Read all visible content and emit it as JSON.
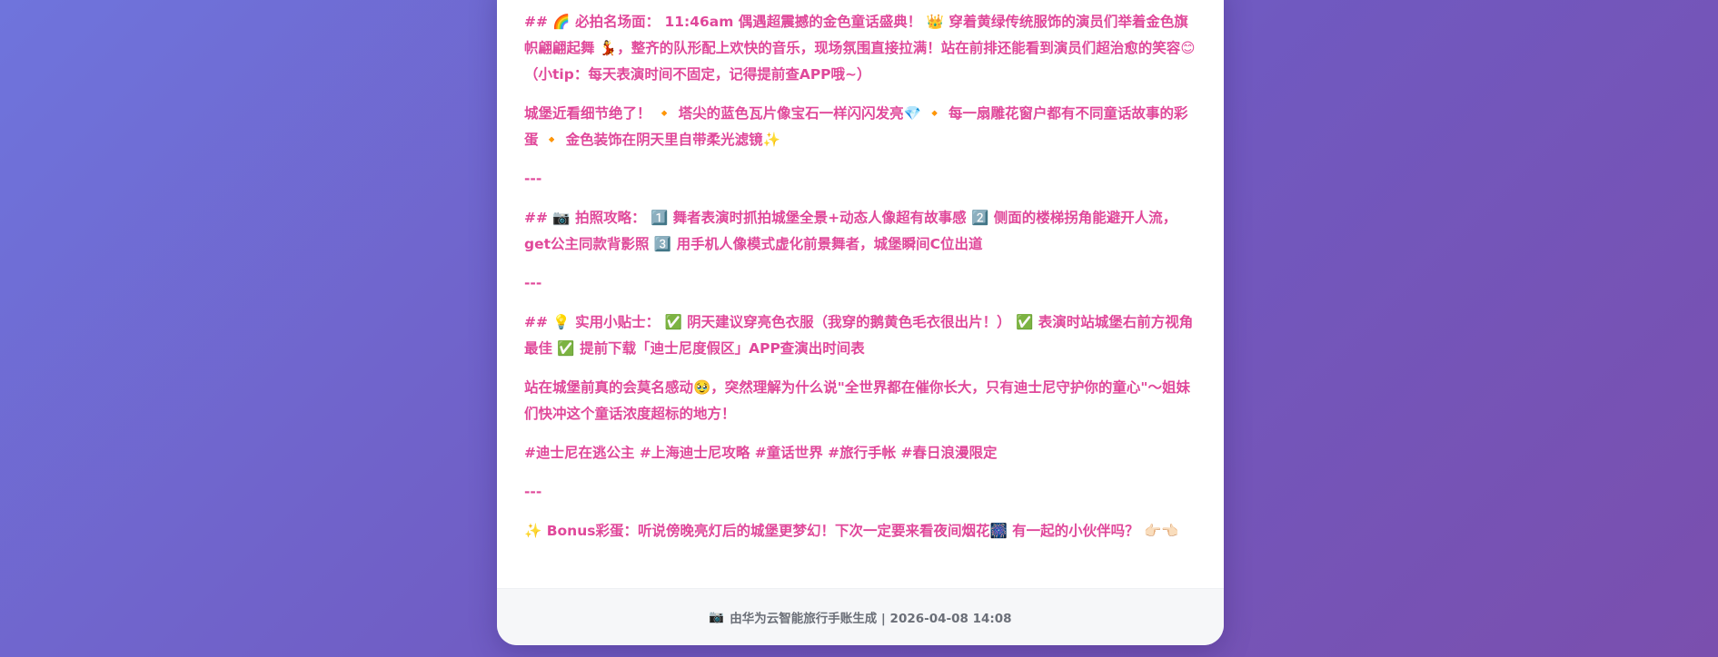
{
  "post": {
    "p1": "## 🌈 必拍名场面： 11:46am 偶遇超震撼的金色童话盛典！ 👑 穿着黄绿传统服饰的演员们举着金色旗帜翩翩起舞 💃，整齐的队形配上欢快的音乐，现场氛围直接拉满！站在前排还能看到演员们超治愈的笑容😊（小tip：每天表演时间不固定，记得提前查APP哦~）",
    "p2": "城堡近看细节绝了！ 🔸 塔尖的蓝色瓦片像宝石一样闪闪发亮💎 🔸 每一扇雕花窗户都有不同童话故事的彩蛋 🔸 金色装饰在阴天里自带柔光滤镜✨",
    "sep1": "---",
    "p3": "## 📷 拍照攻略： 1️⃣ 舞者表演时抓拍城堡全景+动态人像超有故事感 2️⃣ 侧面的楼梯拐角能避开人流，get公主同款背影照 3️⃣ 用手机人像模式虚化前景舞者，城堡瞬间C位出道",
    "sep2": "---",
    "p4": "## 💡 实用小贴士： ✅ 阴天建议穿亮色衣服（我穿的鹅黄色毛衣很出片！） ✅ 表演时站城堡右前方视角最佳 ✅ 提前下载「迪士尼度假区」APP查演出时间表",
    "p5": "站在城堡前真的会莫名感动🥹，突然理解为什么说\"全世界都在催你长大，只有迪士尼守护你的童心\"～姐妹们快冲这个童话浓度超标的地方！",
    "p6": "#迪士尼在逃公主 #上海迪士尼攻略 #童话世界 #旅行手帐 #春日浪漫限定",
    "sep3": "---",
    "p7": "✨ Bonus彩蛋：听说傍晚亮灯后的城堡更梦幻！下次一定要来看夜间烟花🎆 有一起的小伙伴吗？ 👉🏻👈🏻"
  },
  "footer": {
    "icon": "📷",
    "text": "由华为云智能旅行手账生成 | 2026-04-08 14:08"
  },
  "colors": {
    "accent": "#e0489a",
    "background_start": "#6f74dc",
    "background_end": "#7a4fae",
    "footer_text": "#6b6f78"
  }
}
